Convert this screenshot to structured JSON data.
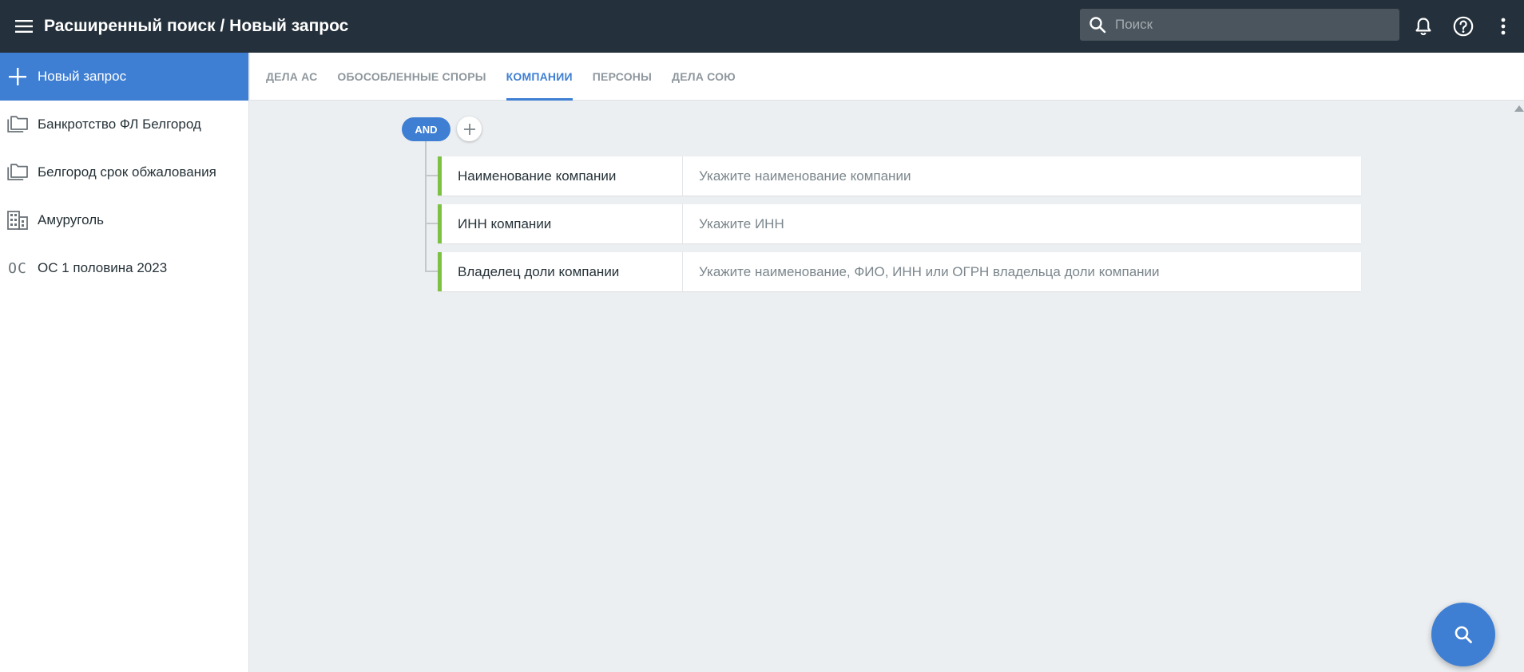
{
  "header": {
    "title": "Расширенный поиск / Новый запрос",
    "search_placeholder": "Поиск",
    "search_value": ""
  },
  "sidebar": {
    "new_query_label": "Новый запрос",
    "items": [
      {
        "label": "Банкротство ФЛ Белгород",
        "icon": "folder-icon"
      },
      {
        "label": "Белгород срок обжалования",
        "icon": "folder-icon"
      },
      {
        "label": "Амуруголь",
        "icon": "company-building-icon"
      },
      {
        "label": "ОС 1 половина 2023",
        "icon": "oc-initials-icon",
        "glyph": "ОС"
      }
    ]
  },
  "tabs": [
    {
      "label": "ДЕЛА АС",
      "active": false
    },
    {
      "label": "ОБОСОБЛЕННЫЕ СПОРЫ",
      "active": false
    },
    {
      "label": "КОМПАНИИ",
      "active": true
    },
    {
      "label": "ПЕРСОНЫ",
      "active": false
    },
    {
      "label": "ДЕЛА СОЮ",
      "active": false
    }
  ],
  "query": {
    "operator": "AND",
    "conditions": [
      {
        "label": "Наименование компании",
        "placeholder": "Укажите наименование компании",
        "value": ""
      },
      {
        "label": "ИНН компании",
        "placeholder": "Укажите ИНН",
        "value": ""
      },
      {
        "label": "Владелец доли компании",
        "placeholder": "Укажите наименование, ФИО, ИНН или ОГРН владельца доли компании",
        "value": ""
      }
    ]
  },
  "colors": {
    "topbar": "#24303b",
    "accent": "#3e7fd4",
    "condition_marker": "#7cc142",
    "background": "#eceff1"
  }
}
